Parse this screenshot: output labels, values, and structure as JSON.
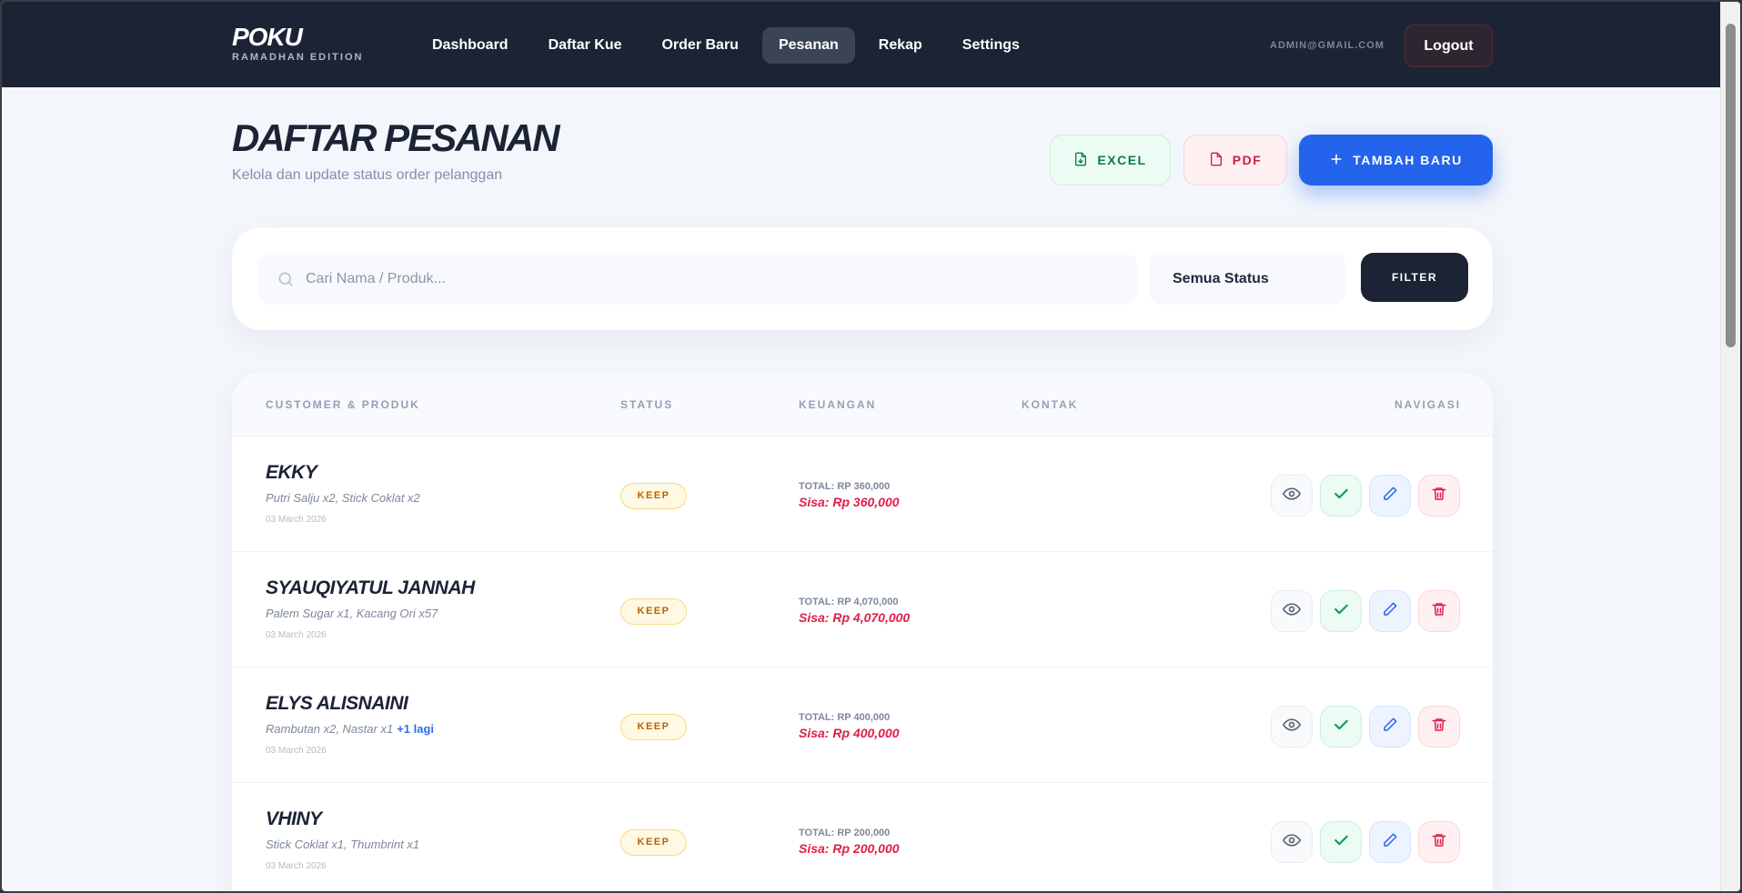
{
  "nav": {
    "brand": "POKU",
    "brand_sub": "RAMADHAN EDITION",
    "items": [
      {
        "label": "Dashboard"
      },
      {
        "label": "Daftar Kue"
      },
      {
        "label": "Order Baru"
      },
      {
        "label": "Pesanan",
        "active": true
      },
      {
        "label": "Rekap"
      },
      {
        "label": "Settings"
      }
    ],
    "user_email": "ADMIN@GMAIL.COM",
    "logout_label": "Logout"
  },
  "header": {
    "title": "DAFTAR PESANAN",
    "subtitle": "Kelola dan update status order pelanggan",
    "excel_label": "EXCEL",
    "pdf_label": "PDF",
    "add_label": "TAMBAH BARU"
  },
  "filter": {
    "search_placeholder": "Cari Nama / Produk...",
    "status_selected": "Semua Status",
    "filter_label": "FILTER"
  },
  "table": {
    "columns": [
      "CUSTOMER & PRODUK",
      "STATUS",
      "KEUANGAN",
      "KONTAK",
      "NAVIGASI"
    ],
    "rows": [
      {
        "name": "EKKY",
        "products": "Putri Salju x2, Stick Coklat x2",
        "more": "",
        "date": "03 March 2026",
        "status": "KEEP",
        "total": "TOTAL: RP 360,000",
        "sisa": "Sisa: Rp 360,000"
      },
      {
        "name": "SYAUQIYATUL JANNAH",
        "products": "Palem Sugar x1, Kacang Ori x57",
        "more": "",
        "date": "03 March 2026",
        "status": "KEEP",
        "total": "TOTAL: RP 4,070,000",
        "sisa": "Sisa: Rp 4,070,000"
      },
      {
        "name": "ELYS ALISNAINI",
        "products": "Rambutan x2, Nastar x1",
        "more": "+1 lagi",
        "date": "03 March 2026",
        "status": "KEEP",
        "total": "TOTAL: RP 400,000",
        "sisa": "Sisa: Rp 400,000"
      },
      {
        "name": "VHINY",
        "products": "Stick Coklat x1, Thumbrint x1",
        "more": "",
        "date": "03 March 2026",
        "status": "KEEP",
        "total": "TOTAL: RP 200,000",
        "sisa": "Sisa: Rp 200,000"
      }
    ]
  },
  "colors": {
    "navbar": "#1b2335",
    "primary": "#2463eb",
    "danger": "#e11d48",
    "success": "#0f7a4a",
    "keep_badge": "#b5640a"
  }
}
